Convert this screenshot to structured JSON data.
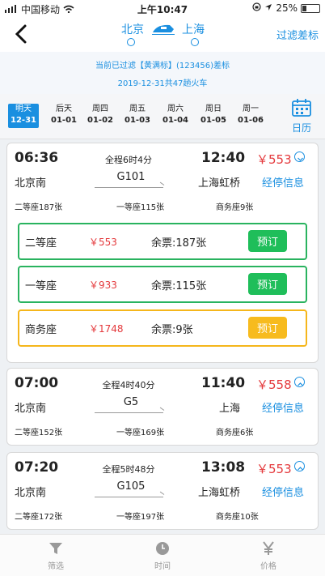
{
  "status_bar": {
    "carrier": "中国移动",
    "time": "上午10:47",
    "battery": "25%"
  },
  "header": {
    "back_icon": "chevron-left-icon",
    "from_city": "北京",
    "to_city": "上海",
    "filter_link": "过滤差标"
  },
  "notice": {
    "line1": "当前已过滤【黄满标】(123456)差标",
    "line2": "2019-12-31共47趟火车"
  },
  "dates": [
    {
      "label": "明天",
      "date": "12-31",
      "active": true
    },
    {
      "label": "后天",
      "date": "01-01"
    },
    {
      "label": "周四",
      "date": "01-02"
    },
    {
      "label": "周五",
      "date": "01-03"
    },
    {
      "label": "周六",
      "date": "01-04"
    },
    {
      "label": "周日",
      "date": "01-05"
    },
    {
      "label": "周一",
      "date": "01-06"
    }
  ],
  "calendar_label": "日历",
  "trains": [
    {
      "dep_time": "06:36",
      "arr_time": "12:40",
      "duration": "全程6时4分",
      "price": "￥553",
      "train_no": "G101",
      "dep_station": "北京南",
      "arr_station": "上海虹桥",
      "stops_link": "经停信息",
      "seats_summary": [
        "二等座187张",
        "一等座115张",
        "商务座9张"
      ],
      "expanded": true,
      "seat_rows": [
        {
          "name": "二等座",
          "price": "￥553",
          "remain": "余票:187张",
          "book": "预订",
          "color": "#1fbe5a"
        },
        {
          "name": "一等座",
          "price": "￥933",
          "remain": "余票:115张",
          "book": "预订",
          "color": "#1fbe5a"
        },
        {
          "name": "商务座",
          "price": "￥1748",
          "remain": "余票:9张",
          "book": "预订",
          "color": "#f7bb1e"
        }
      ]
    },
    {
      "dep_time": "07:00",
      "arr_time": "11:40",
      "duration": "全程4时40分",
      "price": "￥558",
      "train_no": "G5",
      "dep_station": "北京南",
      "arr_station": "上海",
      "stops_link": "经停信息",
      "seats_summary": [
        "二等座152张",
        "一等座169张",
        "商务座6张"
      ],
      "expanded": false
    },
    {
      "dep_time": "07:20",
      "arr_time": "13:08",
      "duration": "全程5时48分",
      "price": "￥553",
      "train_no": "G105",
      "dep_station": "北京南",
      "arr_station": "上海虹桥",
      "stops_link": "经停信息",
      "seats_summary": [
        "二等座172张",
        "一等座197张",
        "商务座10张"
      ],
      "expanded": false
    }
  ],
  "tabbar": [
    {
      "label": "筛选",
      "icon": "funnel-icon"
    },
    {
      "label": "时间",
      "icon": "clock-icon"
    },
    {
      "label": "价格",
      "icon": "yen-icon"
    }
  ],
  "colors": {
    "accent": "#1a8fe0",
    "price": "#e4393c",
    "green": "#1fbe5a",
    "gold": "#f7bb1e"
  }
}
